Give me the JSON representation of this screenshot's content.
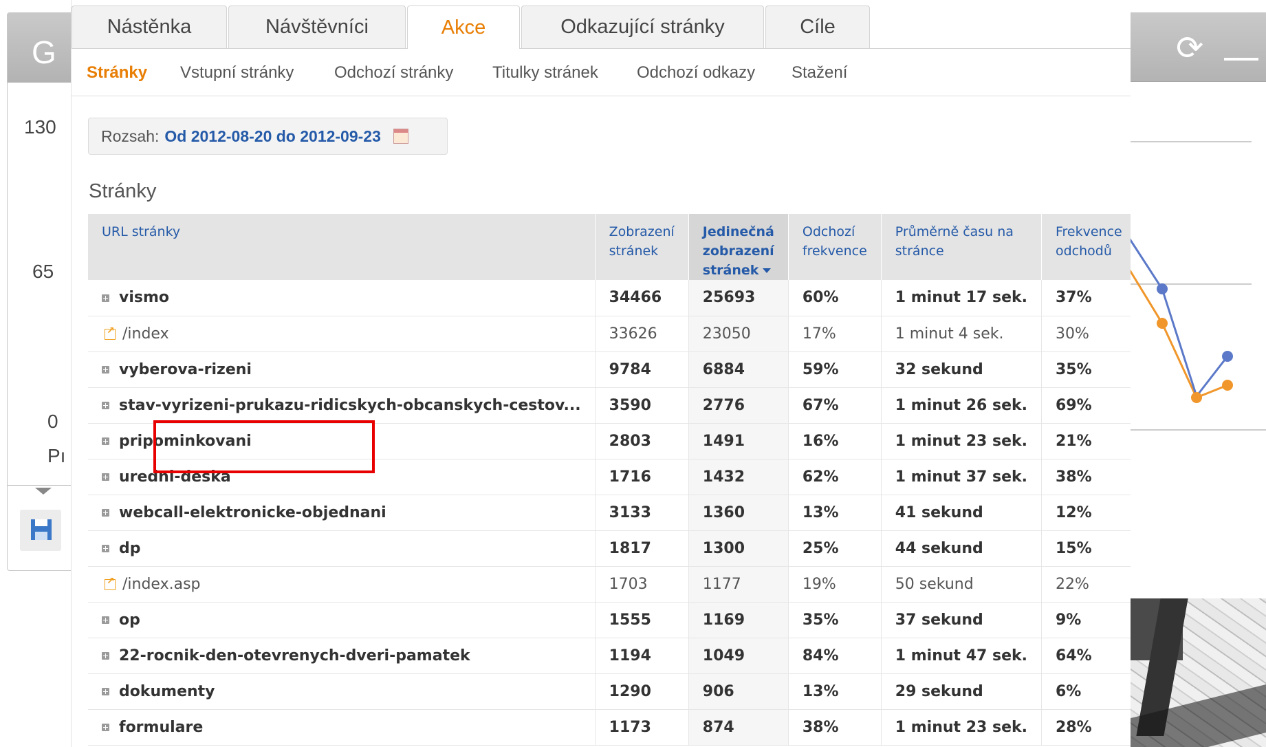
{
  "bg_left": {
    "title_letter": "G",
    "y_axis": [
      "130",
      "65",
      "0"
    ],
    "x_label": "Pı"
  },
  "tabs": [
    {
      "label": "Nástěnka"
    },
    {
      "label": "Návštěvníci"
    },
    {
      "label": "Akce",
      "active": true
    },
    {
      "label": "Odkazující stránky"
    },
    {
      "label": "Cíle"
    }
  ],
  "subnav": [
    {
      "label": "Stránky",
      "active": true
    },
    {
      "label": "Vstupní stránky"
    },
    {
      "label": "Odchozí stránky"
    },
    {
      "label": "Titulky stránek"
    },
    {
      "label": "Odchozí odkazy"
    },
    {
      "label": "Stažení"
    }
  ],
  "range": {
    "label": "Rozsah:",
    "value": "Od 2012-08-20 do 2012-09-23"
  },
  "section_title": "Stránky",
  "table": {
    "headers": [
      "URL stránky",
      "Zobrazení stránek",
      "Jedinečná zobrazení stránek",
      "Odchozí frekvence",
      "Průměrně času na stránce",
      "Frekvence odchodů"
    ],
    "rows": [
      {
        "url": "vismo",
        "type": "folder",
        "views": "34466",
        "unique": "25693",
        "bounce": "60%",
        "time": "1 minut 17 sek.",
        "exit": "37%"
      },
      {
        "url": "/index",
        "type": "page",
        "views": "33626",
        "unique": "23050",
        "bounce": "17%",
        "time": "1 minut 4 sek.",
        "exit": "30%"
      },
      {
        "url": "vyberova-rizeni",
        "type": "folder",
        "views": "9784",
        "unique": "6884",
        "bounce": "59%",
        "time": "32 sekund",
        "exit": "35%"
      },
      {
        "url": "stav-vyrizeni-prukazu-ridicskych-obcanskych-cestov...",
        "type": "folder",
        "views": "3590",
        "unique": "2776",
        "bounce": "67%",
        "time": "1 minut 26 sek.",
        "exit": "69%"
      },
      {
        "url": "pripominkovani",
        "type": "folder",
        "views": "2803",
        "unique": "1491",
        "bounce": "16%",
        "time": "1 minut 23 sek.",
        "exit": "21%"
      },
      {
        "url": "uredni-deska",
        "type": "folder",
        "views": "1716",
        "unique": "1432",
        "bounce": "62%",
        "time": "1 minut 37 sek.",
        "exit": "38%"
      },
      {
        "url": "webcall-elektronicke-objednani",
        "type": "folder",
        "views": "3133",
        "unique": "1360",
        "bounce": "13%",
        "time": "41 sekund",
        "exit": "12%"
      },
      {
        "url": "dp",
        "type": "folder",
        "views": "1817",
        "unique": "1300",
        "bounce": "25%",
        "time": "44 sekund",
        "exit": "15%"
      },
      {
        "url": "/index.asp",
        "type": "page",
        "views": "1703",
        "unique": "1177",
        "bounce": "19%",
        "time": "50 sekund",
        "exit": "22%"
      },
      {
        "url": "op",
        "type": "folder",
        "views": "1555",
        "unique": "1169",
        "bounce": "35%",
        "time": "37 sekund",
        "exit": "9%"
      },
      {
        "url": "22-rocnik-den-otevrenych-dveri-pamatek",
        "type": "folder",
        "views": "1194",
        "unique": "1049",
        "bounce": "84%",
        "time": "1 minut 47 sek.",
        "exit": "64%"
      },
      {
        "url": "dokumenty",
        "type": "folder",
        "views": "1290",
        "unique": "906",
        "bounce": "13%",
        "time": "29 sekund",
        "exit": "6%"
      },
      {
        "url": "formulare",
        "type": "folder",
        "views": "1173",
        "unique": "874",
        "bounce": "38%",
        "time": "1 minut 23 sek.",
        "exit": "28%"
      }
    ]
  },
  "colors": {
    "accent": "#e87e04",
    "link": "#255aa8",
    "highlight": "#e80000",
    "series_blue": "#5b79c8",
    "series_orange": "#f0962a"
  }
}
